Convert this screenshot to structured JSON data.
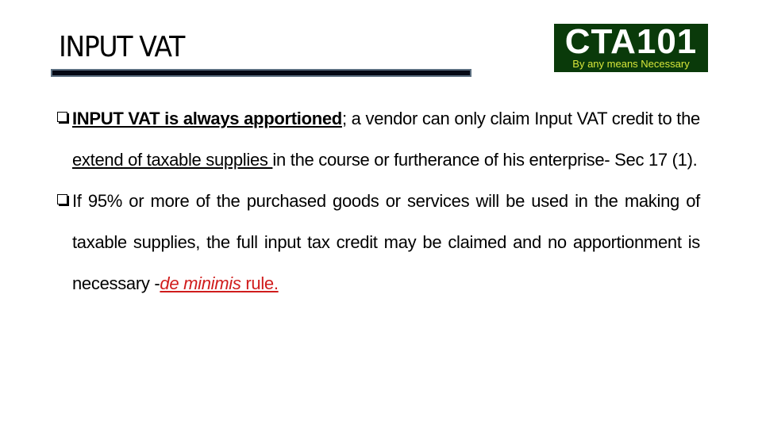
{
  "slide": {
    "title": "INPUT VAT",
    "logo": {
      "name": "CTA101",
      "tagline": "By any means Necessary",
      "background_color": "#0a3a0a",
      "name_color": "#ffffff",
      "tagline_color": "#d7e63a"
    },
    "bullets": [
      {
        "icon": "hollow-square-bullet-icon",
        "bold_underlined": "INPUT VAT is always apportioned",
        "text_after_bold": "; a vendor can only claim Input VAT credit to the ",
        "underlined": "extend of taxable supplies ",
        "text_end": "in the course or furtherance of his enterprise- Sec 17 (1)."
      },
      {
        "icon": "hollow-square-bullet-icon",
        "text": "If 95% or more of the purchased goods or services will be used in the making of taxable supplies, the full input tax credit may be claimed and no apportionment is necessary -",
        "italic_red": "de minimis",
        "red_end": " rule.",
        "accent_color": "#d01c1c"
      }
    ]
  }
}
